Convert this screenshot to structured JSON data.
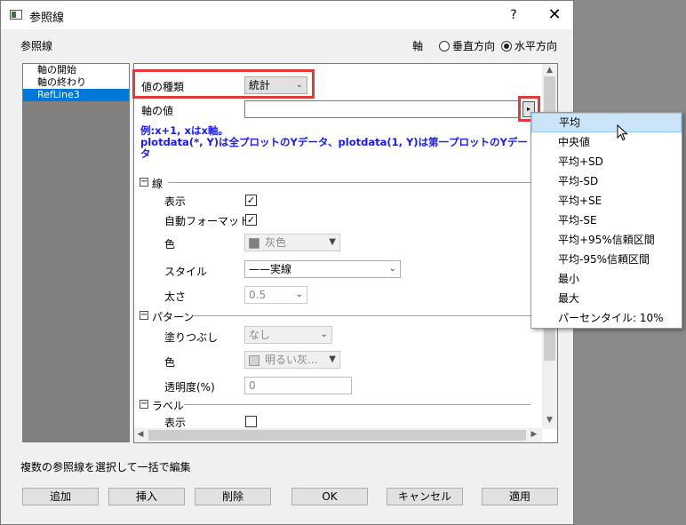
{
  "window": {
    "title": "参照線",
    "help": "?",
    "close": "✕"
  },
  "header": {
    "section_label": "参照線",
    "axis_label": "軸",
    "radio_vertical": "垂直方向",
    "radio_horizontal": "水平方向",
    "selected_radio": "水平方向"
  },
  "list": {
    "items": [
      "軸の開始",
      "軸の終わり",
      "RefLine3"
    ],
    "selected_index": 2
  },
  "panel": {
    "value_type_label": "値の種類",
    "value_type_value": "統計",
    "axis_value_label": "軸の値",
    "axis_value": "",
    "hint_line1": "例:x+1, xはx軸。",
    "hint_line2": "plotdata(*, Y)は全プロットのYデータ、plotdata(1, Y)は第一プロットのYデー",
    "hint_line3": "タ",
    "group_line": "線",
    "show_label": "表示",
    "show_checked": true,
    "autoformat_label": "自動フォーマット",
    "autoformat_checked": true,
    "color_label": "色",
    "color_value": "灰色",
    "style_label": "スタイル",
    "style_value": "——実線",
    "width_label": "太さ",
    "width_value": "0.5",
    "group_pattern": "パターン",
    "fill_label": "塗りつぶし",
    "fill_value": "なし",
    "pattern_color_label": "色",
    "pattern_color_value": "明るい灰...",
    "transparency_label": "透明度(%)",
    "transparency_value": "0",
    "group_label": "ラベル",
    "label_show_label": "表示",
    "label_show_checked": false
  },
  "footer": {
    "multi_edit_text": "複数の参照線を選択して一括で編集",
    "buttons": [
      "追加",
      "挿入",
      "削除",
      "OK",
      "キャンセル",
      "適用"
    ]
  },
  "dropdown": {
    "options": [
      "平均",
      "中央値",
      "平均+SD",
      "平均-SD",
      "平均+SE",
      "平均-SE",
      "平均+95%信頼区間",
      "平均-95%信頼区間",
      "最小",
      "最大",
      "パーセンタイル: 10%"
    ],
    "hover_index": 0
  },
  "colors": {
    "highlight": "#e53935",
    "hint_text": "#1a1aff",
    "selection": "#0078d7",
    "gray_swatch": "#808080",
    "light_gray_swatch": "#d3d3d3"
  }
}
